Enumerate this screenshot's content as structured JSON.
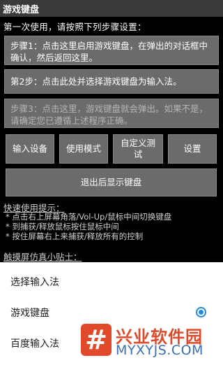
{
  "app": {
    "title": "游戏键盘"
  },
  "intro": "第一次使用，请按照下列步骤设置：",
  "steps": [
    {
      "text": "步骤1：点击这里启用游戏键盘，在弹出的对话框中确认，然后返回这里。"
    },
    {
      "text": "第2步：点击此处并选择游戏键盘为输入法。"
    },
    {
      "text": "步骤3：点击这里，游戏键盘就会弹出。如果不是，请确定您已遵循上述程序正确。"
    }
  ],
  "buttons": {
    "input_device": "输入设备",
    "usage_mode": "使用模式",
    "custom_test": "自定义测试",
    "settings": "设置",
    "exit_show": "退出后显示键盘"
  },
  "quick_tips": {
    "title": "快速使用提示：",
    "items": [
      "* 点击右上屏幕角落/Vol-Up/鼠标中间切换键盘",
      "* 到捕获/释放鼠标按住鼠标中间",
      "* 按住屏幕右上来捕获/释放所有的控制"
    ]
  },
  "sim_tips": {
    "title": "触摸屏仿真小贴士："
  },
  "input_method_sheet": {
    "title": "选择输入法",
    "options": [
      {
        "label": "游戏键盘",
        "selected": true
      },
      {
        "label": "百度输入法",
        "selected": false
      }
    ]
  },
  "watermark": {
    "logo_char": "#",
    "name": "兴业软件园",
    "url": "MYXYJS.COM"
  },
  "colors": {
    "accent": "#1e8de0",
    "watermark_red": "#e04a2a",
    "watermark_blue": "#3a6fb5"
  }
}
